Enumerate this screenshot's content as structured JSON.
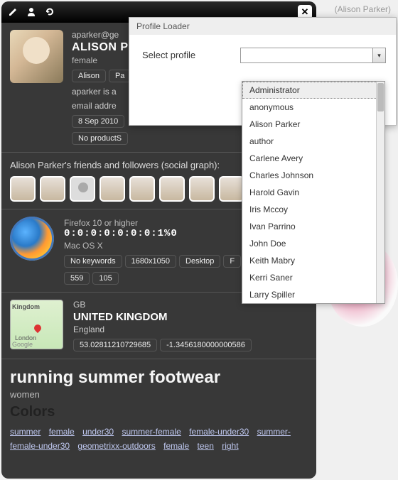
{
  "top_right": "(Alison Parker)",
  "modal": {
    "title": "Profile Loader",
    "label": "Select profile",
    "value": "",
    "options": [
      "Administrator",
      "anonymous",
      "Alison Parker",
      "author",
      "Carlene Avery",
      "Charles Johnson",
      "Harold Gavin",
      "Iris Mccoy",
      "Ivan Parrino",
      "John Doe",
      "Keith Mabry",
      "Kerri Saner",
      "Larry Spiller"
    ],
    "selected_index": 0
  },
  "profile": {
    "email": "aparker@ge",
    "name": "ALISON P",
    "gender": "female",
    "tags": [
      "Alison",
      "Pa"
    ],
    "desc1": "aparker is a",
    "desc2": "email addre",
    "date": "8 Sep 2010",
    "products": "No productS"
  },
  "friends": {
    "label": "Alison Parker's friends and followers (social graph):"
  },
  "tech": {
    "browser": "Firefox 10 or higher",
    "ip": "0:0:0:0:0:0:0:1%0",
    "os": "Mac OS X",
    "tags1": [
      "No keywords",
      "1680x1050",
      "Desktop",
      "F"
    ],
    "tags2": [
      "559",
      "105"
    ]
  },
  "geo": {
    "map_label1": "Kingdom",
    "map_label2": "London",
    "map_credit": "Google",
    "cc": "GB",
    "country": "UNITED KINGDOM",
    "region": "England",
    "lat": "53.02811210729685",
    "lon": "-1.3456180000000586"
  },
  "search": {
    "title": "running summer footwear",
    "sub": "women",
    "colors": "Colors",
    "netspace": [
      "summer",
      "female",
      "under30",
      "summer-female",
      "female-under30",
      "summer-female-under30",
      "geometrixx-outdoors",
      "female",
      "teen",
      "right"
    ]
  }
}
